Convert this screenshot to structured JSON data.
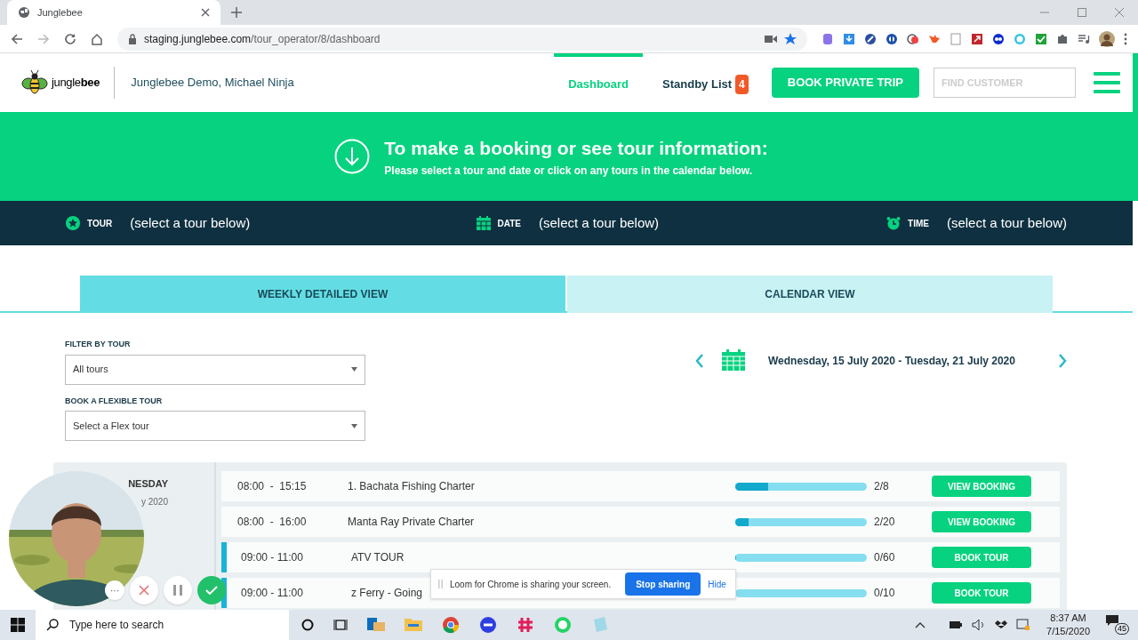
{
  "browser": {
    "tab_title": "Junglebee",
    "url_host": "staging.junglebee.com",
    "url_path": "/tour_operator/8/dashboard"
  },
  "header": {
    "logo": "jungle**bee**",
    "operator": "Junglebee Demo, Michael Ninja",
    "nav": [
      {
        "label": "Dashboard",
        "selected": true
      },
      {
        "label": "Standby List",
        "badge": "4",
        "selected": false
      }
    ],
    "book_button": "BOOK PRIVATE TRIP",
    "search": {
      "placeholder": "FIND CUSTOMER"
    }
  },
  "banner": {
    "title": "To make a booking or see tour information:",
    "subtitle": "Please select a tour and date or click on any tours in the calendar below."
  },
  "selection": [
    {
      "kind": "tour",
      "label": "TOUR",
      "value": "(select a tour below)"
    },
    {
      "kind": "date",
      "label": "DATE",
      "value": "(select a tour below)"
    },
    {
      "kind": "time",
      "label": "TIME",
      "value": "(select a tour below)"
    }
  ],
  "view_tabs": [
    {
      "label": "WEEKLY DETAILED VIEW",
      "selected": true
    },
    {
      "label": "CALENDAR VIEW",
      "selected": false
    }
  ],
  "filters": [
    {
      "label": "FILTER BY TOUR",
      "value": "All tours"
    },
    {
      "label": "BOOK A FLEXIBLE TOUR",
      "value": "Select a Flex tour"
    }
  ],
  "date_range": "Wednesday, 15 July 2020 - Tuesday, 21 July 2020",
  "day": {
    "weekday": "NESDAY",
    "date": "y 2020"
  },
  "tours": [
    {
      "time": "08:00  -  15:15",
      "name": "1. Bachata Fishing Charter",
      "level": 0.25,
      "count": "2/8",
      "action": "VIEW BOOKING",
      "marked": false
    },
    {
      "time": "08:00  -  16:00",
      "name": "Manta Ray Private Charter",
      "level": 0.1,
      "count": "2/20",
      "action": "VIEW BOOKING",
      "marked": false
    },
    {
      "time": "09:00 - 11:00",
      "name": "ATV TOUR",
      "level": 0,
      "count": "0/60",
      "action": "BOOK TOUR",
      "marked": true
    },
    {
      "time": "09:00 - 11:00",
      "name": "z Ferry - Going",
      "level": 0,
      "count": "0/10",
      "action": "BOOK TOUR",
      "marked": true
    }
  ],
  "recorder": {
    "more": "···"
  },
  "loom": {
    "message": "Loom for Chrome is sharing your screen.",
    "stop": "Stop sharing",
    "hide": "Hide"
  },
  "taskbar": {
    "search_placeholder": "Type here to search",
    "time": "8:37 AM",
    "date": "7/15/2020",
    "notifications": "45"
  }
}
